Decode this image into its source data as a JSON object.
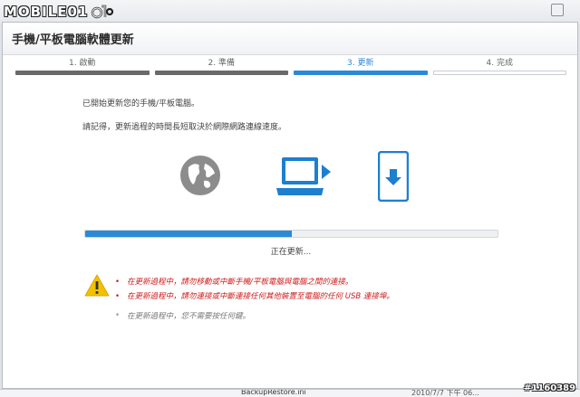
{
  "watermark": {
    "brand": "MOBILE01",
    "post_id": "#1160389"
  },
  "dialog": {
    "title": "手機/平板電腦軟體更新"
  },
  "steps": [
    {
      "label": "1. 啟動",
      "state": "done"
    },
    {
      "label": "2. 準備",
      "state": "done"
    },
    {
      "label": "3. 更新",
      "state": "active"
    },
    {
      "label": "4. 完成",
      "state": "todo"
    }
  ],
  "messages": {
    "line1": "已開始更新您的手機/平板電腦。",
    "line2": "請記得，更新過程的時間長短取決於網際網路連線速度。"
  },
  "icons": {
    "globe": "globe-icon",
    "laptop": "laptop-icon",
    "phone": "phone-download-icon",
    "warning": "warning-icon"
  },
  "progress": {
    "fraction": 0.5,
    "status_text": "正在更新..."
  },
  "warnings": [
    "在更新過程中，請勿移動或中斷手機/平板電腦與電腦之間的連接。",
    "在更新過程中，請勿連接或中斷連接任何其他裝置至電腦的任何 USB 連接埠。"
  ],
  "note": "在更新過程中，您不需要按任何鍵。",
  "background_window": {
    "file_name": "BackupRestore.ini",
    "date": "2010/7/7 下午 06..."
  },
  "colors": {
    "accent": "#2b8ad8",
    "warning_text": "#cc1a1a",
    "warning_icon": "#f2c200"
  }
}
